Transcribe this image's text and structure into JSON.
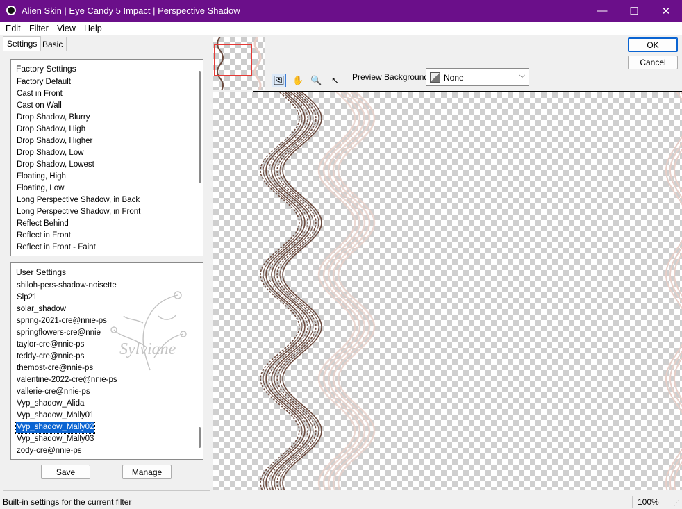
{
  "window": {
    "title": "Alien Skin | Eye Candy 5 Impact | Perspective Shadow",
    "accent_color": "#6b0f8a",
    "controls": {
      "minimize": "—",
      "maximize": "☐",
      "close": "✕"
    }
  },
  "menu": [
    "Edit",
    "Filter",
    "View",
    "Help"
  ],
  "tabs": [
    "Settings",
    "Basic"
  ],
  "factory_settings": {
    "header": "Factory Settings",
    "items": [
      "Factory Default",
      "Cast in Front",
      "Cast on Wall",
      "Drop Shadow, Blurry",
      "Drop Shadow, High",
      "Drop Shadow, Higher",
      "Drop Shadow, Low",
      "Drop Shadow, Lowest",
      "Floating, High",
      "Floating, Low",
      "Long Perspective Shadow, in Back",
      "Long Perspective Shadow, in Front",
      "Reflect Behind",
      "Reflect in Front",
      "Reflect in Front - Faint"
    ]
  },
  "user_settings": {
    "header": "User Settings",
    "items": [
      "shiloh-pers-shadow-noisette",
      "Slp21",
      "solar_shadow",
      "spring-2021-cre@nnie-ps",
      "springflowers-cre@nnie",
      "taylor-cre@nnie-ps",
      "teddy-cre@nnie-ps",
      "themost-cre@nnie-ps",
      "valentine-2022-cre@nnie-ps",
      "vallerie-cre@nnie-ps",
      "Vyp_shadow_Alida",
      "Vyp_shadow_Mally01",
      "Vyp_shadow_Mally02",
      "Vyp_shadow_Mally03",
      "zody-cre@nnie-ps"
    ],
    "selected": "Vyp_shadow_Mally02"
  },
  "watermark_text": "Sylviane",
  "buttons": {
    "save": "Save",
    "manage": "Manage",
    "ok": "OK",
    "cancel": "Cancel"
  },
  "tools": [
    {
      "name": "navigate-icon",
      "glyph": "🖼"
    },
    {
      "name": "hand-icon",
      "glyph": "✋"
    },
    {
      "name": "zoom-icon",
      "glyph": "🔍"
    },
    {
      "name": "pointer-icon",
      "glyph": "↖"
    }
  ],
  "preview_background": {
    "label": "Preview Background:",
    "value": "None"
  },
  "status": {
    "text": "Built-in settings for the current filter",
    "zoom": "100%"
  },
  "colors": {
    "shadow_dark": "#6b4a3e",
    "shadow_light": "#e8cfc8",
    "selection": "#0a64d2"
  }
}
